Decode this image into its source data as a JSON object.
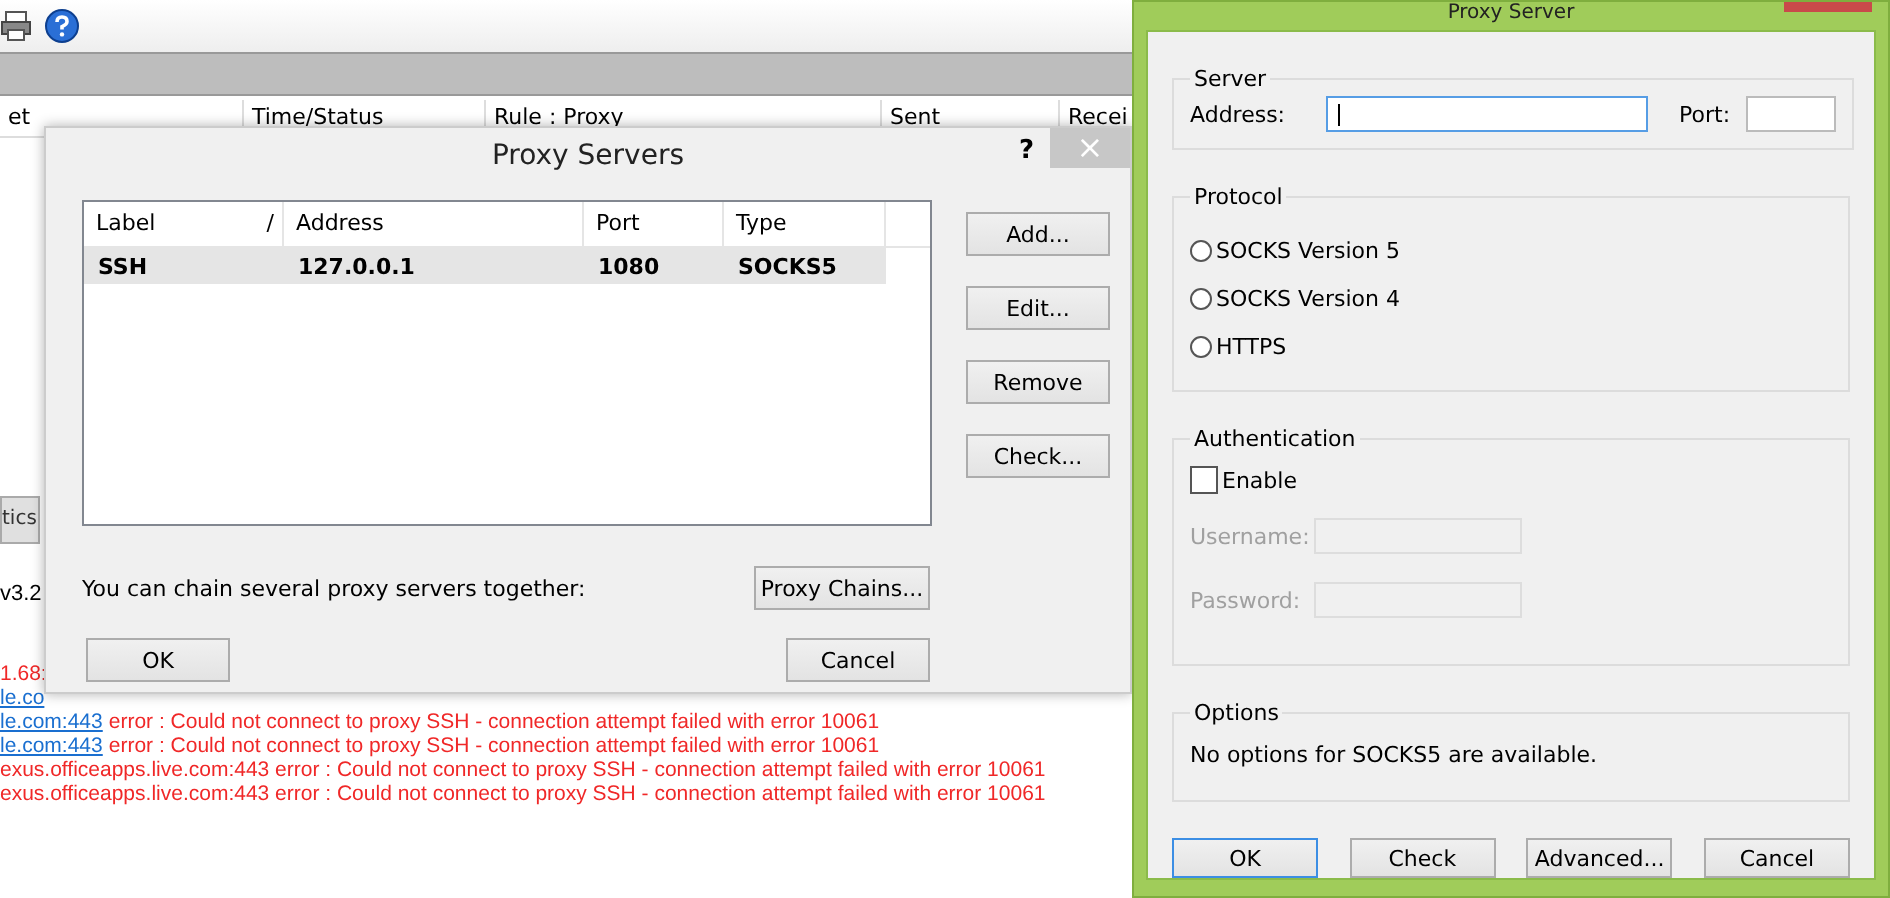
{
  "background_window": {
    "columns": [
      "et",
      "Time/Status",
      "Rule : Proxy",
      "Sent",
      "Recei"
    ],
    "tab": "tics",
    "version": "v3.2",
    "log": [
      {
        "text": "1.68:",
        "kind": "error"
      },
      {
        "link": "le.co",
        "kind": "link"
      },
      {
        "link": "le.com:443",
        "text": "error : Could not connect to proxy SSH - connection attempt failed with error 10061",
        "kind": "error"
      },
      {
        "link": "le.com:443",
        "text": "error : Could not connect to proxy SSH - connection attempt failed with error 10061",
        "kind": "error"
      },
      {
        "text": "exus.officeapps.live.com:443 error : Could not connect to proxy SSH - connection attempt failed with error 10061",
        "kind": "error"
      },
      {
        "text": "exus.officeapps.live.com:443 error : Could not connect to proxy SSH - connection attempt failed with error 10061",
        "kind": "error"
      }
    ]
  },
  "proxy_servers_dialog": {
    "title": "Proxy Servers",
    "help": "?",
    "close": "×",
    "columns": [
      "Label",
      "Address",
      "Port",
      "Type"
    ],
    "sort_mark": "/",
    "rows": [
      {
        "cells": [
          "SSH",
          "127.0.0.1",
          "1080",
          "SOCKS5"
        ],
        "selected": true
      }
    ],
    "side_buttons": [
      "Add...",
      "Edit...",
      "Remove",
      "Check..."
    ],
    "chain_text": "You can chain several proxy servers together:",
    "chain_button": "Proxy Chains...",
    "ok": "OK",
    "cancel": "Cancel"
  },
  "proxy_server_dialog": {
    "title": "Proxy Server",
    "server": {
      "legend": "Server",
      "address_label": "Address:",
      "port_label": "Port:"
    },
    "protocol": {
      "legend": "Protocol",
      "options": [
        {
          "label": "SOCKS Version 5",
          "selected": false
        },
        {
          "label": "SOCKS Version 4",
          "selected": false
        },
        {
          "label": "HTTPS",
          "selected": false
        }
      ]
    },
    "authentication": {
      "legend": "Authentication",
      "enable": {
        "label": "Enable",
        "checked": false
      },
      "username_label": "Username:",
      "password_label": "Password:",
      "disabled": true
    },
    "options": {
      "legend": "Options",
      "text": "No options for SOCKS5 are available."
    },
    "buttons": [
      "OK",
      "Check",
      "Advanced...",
      "Cancel"
    ]
  }
}
